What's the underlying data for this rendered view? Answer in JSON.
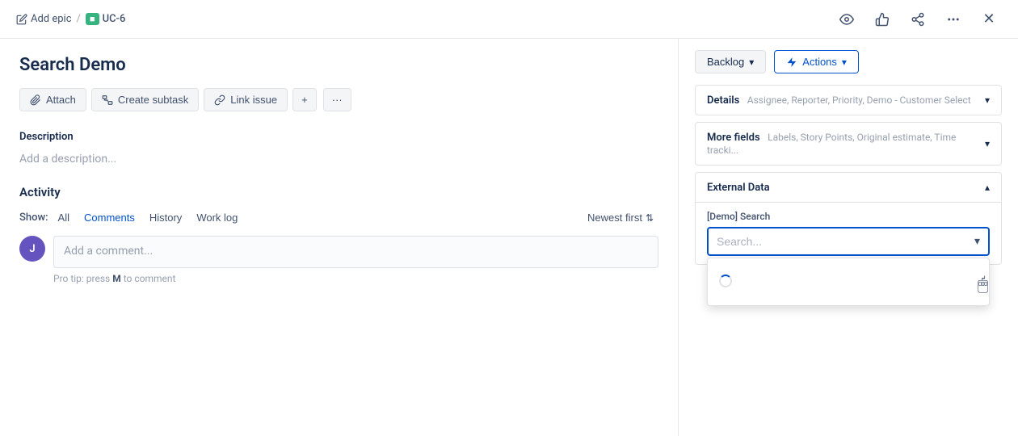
{
  "breadcrumb": {
    "add_epic_label": "Add epic",
    "separator": "/",
    "issue_id": "UC-6",
    "issue_badge_color": "#36b37e"
  },
  "top_actions": {
    "watch_icon": "eye",
    "like_icon": "thumbs-up",
    "share_icon": "share",
    "more_icon": "ellipsis",
    "close_icon": "×"
  },
  "issue": {
    "title": "Search Demo",
    "description_label": "Description",
    "description_placeholder": "Add a description...",
    "action_buttons": [
      {
        "id": "attach",
        "label": "Attach",
        "icon": "paperclip"
      },
      {
        "id": "create-subtask",
        "label": "Create subtask",
        "icon": "subtask"
      },
      {
        "id": "link-issue",
        "label": "Link issue",
        "icon": "link"
      }
    ],
    "action_more_label": "...",
    "action_expand_label": "+"
  },
  "activity": {
    "title": "Activity",
    "show_label": "Show:",
    "filters": [
      {
        "id": "all",
        "label": "All",
        "active": false
      },
      {
        "id": "comments",
        "label": "Comments",
        "active": true
      },
      {
        "id": "history",
        "label": "History",
        "active": false
      },
      {
        "id": "worklog",
        "label": "Work log",
        "active": false
      }
    ],
    "sort_label": "Newest first",
    "comment_placeholder": "Add a comment...",
    "pro_tip_text": "Pro tip:",
    "pro_tip_key": "M",
    "pro_tip_action": "to comment"
  },
  "right_panel": {
    "backlog_label": "Backlog",
    "actions_label": "Actions",
    "details": {
      "label": "Details",
      "sub": "Assignee, Reporter, Priority, Demo - Customer Select"
    },
    "more_fields": {
      "label": "More fields",
      "sub": "Labels, Story Points, Original estimate, Time tracki..."
    },
    "external_data": {
      "section_title": "External Data",
      "field_label": "[Demo] Search",
      "search_placeholder": "Search...",
      "is_open": true
    }
  }
}
